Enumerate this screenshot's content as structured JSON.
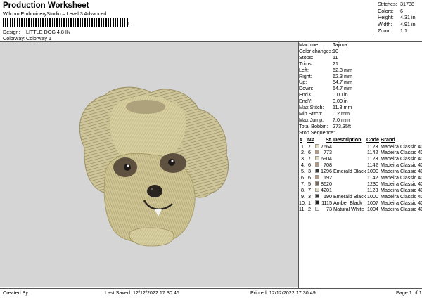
{
  "header": {
    "title": "Production Worksheet",
    "subtitle": "Wilcom EmbroideryStudio – Level 3 Advanced",
    "barcode_number": "1",
    "design_label": "Design:",
    "design_value": "LITTLE DOG 4,8 IN",
    "colorway_label": "Colorway:",
    "colorway_value": "Colorway 1"
  },
  "summary": [
    {
      "label": "Stitches:",
      "value": "31738"
    },
    {
      "label": "Colors:",
      "value": "6"
    },
    {
      "label": "Height:",
      "value": "4.31 in"
    },
    {
      "label": "Width:",
      "value": "4.91 in"
    },
    {
      "label": "Zoom:",
      "value": "1:1"
    }
  ],
  "machine_info": [
    {
      "label": "Machine:",
      "value": "Tajima"
    },
    {
      "label": "Color changes:",
      "value": "10"
    },
    {
      "label": "Stops:",
      "value": "11"
    },
    {
      "label": "Trims:",
      "value": "21"
    },
    {
      "label": "Left:",
      "value": "62.3 mm"
    },
    {
      "label": "Right:",
      "value": "62.3 mm"
    },
    {
      "label": "Up:",
      "value": "54.7 mm"
    },
    {
      "label": "Down:",
      "value": "54.7 mm"
    },
    {
      "label": "EndX:",
      "value": "0.00 in"
    },
    {
      "label": "EndY:",
      "value": "0.00 in"
    },
    {
      "label": "Max Stitch:",
      "value": "11.8 mm"
    },
    {
      "label": "Min Stitch:",
      "value": "0.2 mm"
    },
    {
      "label": "Max Jump:",
      "value": "7.0 mm"
    },
    {
      "label": "Total Bobbin:",
      "value": "273.35ft"
    }
  ],
  "stop_sequence": {
    "title": "Stop Sequence:",
    "columns": [
      "#",
      "N#",
      "St.",
      "Description",
      "Code",
      "Brand"
    ],
    "rows": [
      {
        "num": "1.",
        "n": "7",
        "color": "#e6dcc0",
        "stitches": "7664",
        "description": "",
        "code": "1123",
        "brand": "Madeira Classic 40"
      },
      {
        "num": "2.",
        "n": "6",
        "color": "#b89880",
        "stitches": "773",
        "description": "",
        "code": "1142",
        "brand": "Madeira Classic 40"
      },
      {
        "num": "3.",
        "n": "7",
        "color": "#e6dcc0",
        "stitches": "6904",
        "description": "",
        "code": "1123",
        "brand": "Madeira Classic 40"
      },
      {
        "num": "4.",
        "n": "6",
        "color": "#b89880",
        "stitches": "708",
        "description": "",
        "code": "1142",
        "brand": "Madeira Classic 40"
      },
      {
        "num": "5.",
        "n": "3",
        "color": "#3a3532",
        "stitches": "1296",
        "description": "Emerald Black",
        "code": "1000",
        "brand": "Madeira Classic 40"
      },
      {
        "num": "6.",
        "n": "6",
        "color": "#b89880",
        "stitches": "192",
        "description": "",
        "code": "1142",
        "brand": "Madeira Classic 40"
      },
      {
        "num": "7.",
        "n": "5",
        "color": "#7a6a58",
        "stitches": "8620",
        "description": "",
        "code": "1230",
        "brand": "Madeira Classic 40"
      },
      {
        "num": "8.",
        "n": "7",
        "color": "#e6dcc0",
        "stitches": "4201",
        "description": "",
        "code": "1123",
        "brand": "Madeira Classic 40"
      },
      {
        "num": "9.",
        "n": "3",
        "color": "#3a3532",
        "stitches": "190",
        "description": "Emerald Black",
        "code": "1000",
        "brand": "Madeira Classic 40"
      },
      {
        "num": "10.",
        "n": "1",
        "color": "#222222",
        "stitches": "1115",
        "description": "Amber Black",
        "code": "1007",
        "brand": "Madeira Classic 40"
      },
      {
        "num": "11.",
        "n": "2",
        "color": "#f4f4f0",
        "stitches": "73",
        "description": "Natural White",
        "code": "1004",
        "brand": "Madeira Classic 40"
      }
    ]
  },
  "footer": {
    "created_by": "Created By:",
    "last_saved": "Last Saved: 12/12/2022 17:30:46",
    "printed": "Printed: 12/12/2022 17:30:49",
    "page": "Page 1 of 1"
  }
}
